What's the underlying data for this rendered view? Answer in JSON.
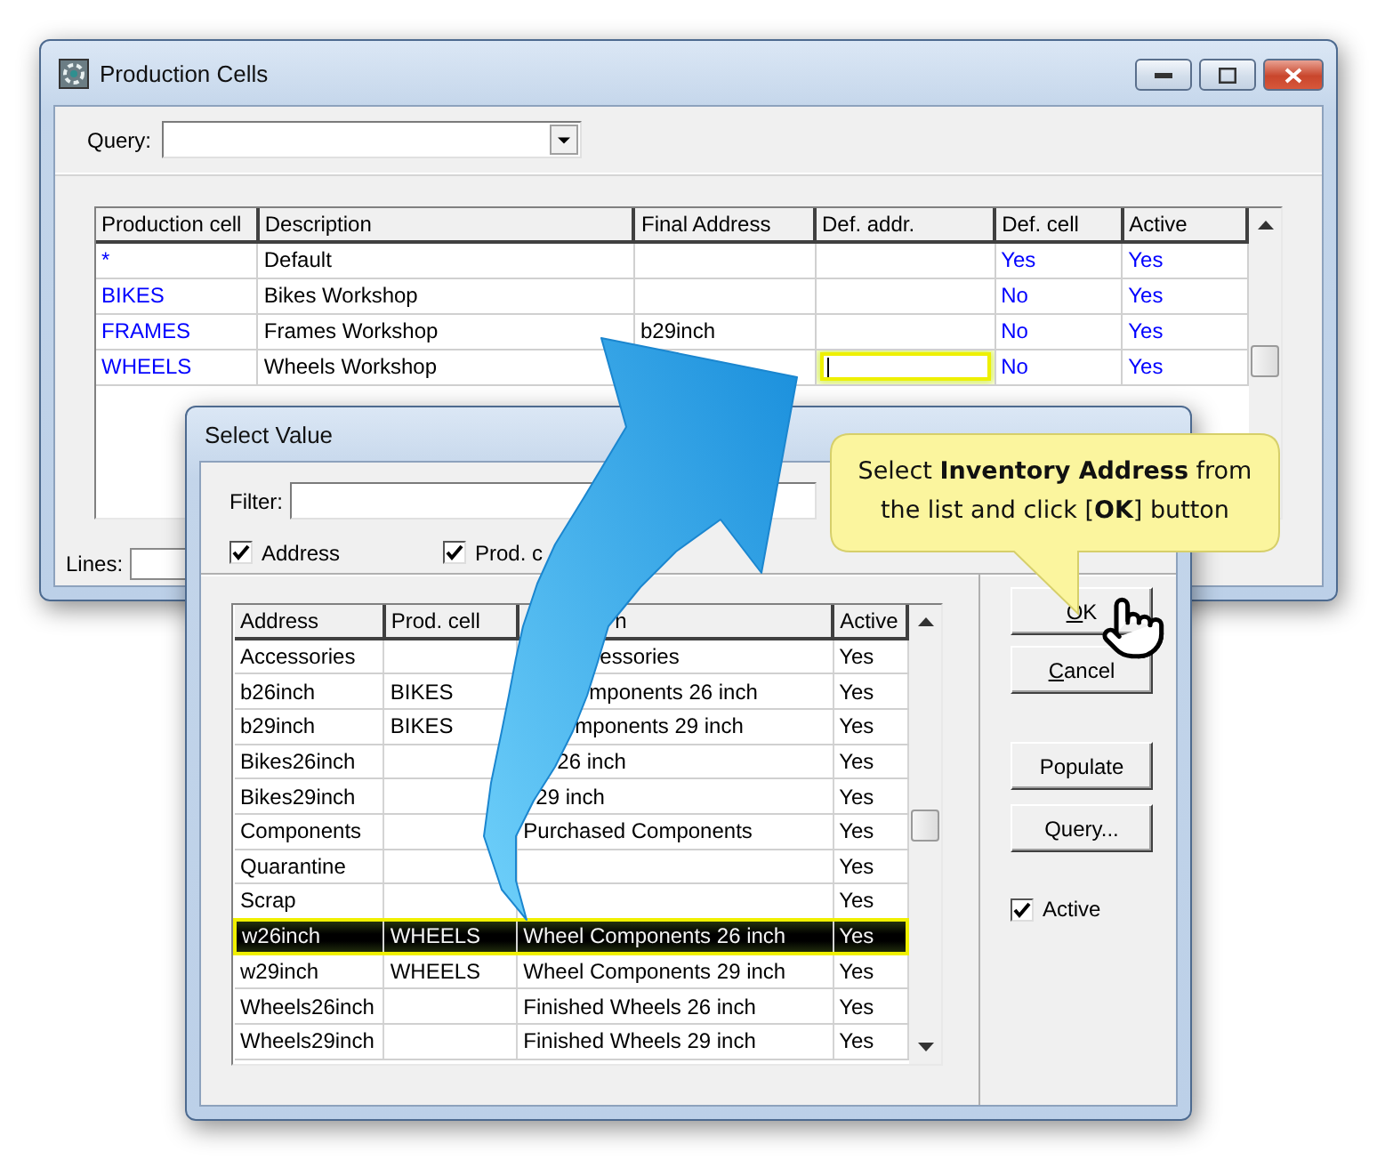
{
  "main_window": {
    "title": "Production Cells",
    "query": {
      "label": "Query:"
    },
    "table": {
      "columns": [
        "Production cell",
        "Description",
        "Final Address",
        "Def. addr.",
        "Def. cell",
        "Active"
      ],
      "rows": [
        {
          "production_cell": "*",
          "description": "Default",
          "def_cell": "Yes",
          "active": "Yes",
          "editing": false
        },
        {
          "production_cell": "BIKES",
          "description": "Bikes Workshop",
          "def_cell": "No",
          "active": "Yes",
          "editing": false
        },
        {
          "production_cell": "FRAMES",
          "description": "Frames Workshop",
          "final_address": "b29inch",
          "def_cell": "No",
          "active": "Yes",
          "editing": false
        },
        {
          "production_cell": "WHEELS",
          "description": "Wheels Workshop",
          "def_cell": "No",
          "active": "Yes",
          "editing": true
        }
      ]
    },
    "status_bar": {
      "label": "Lines:"
    }
  },
  "dialog": {
    "title": "Select Value",
    "filter": {
      "label": "Filter:"
    },
    "checkboxes": [
      {
        "label": "Address",
        "checked": true
      },
      {
        "label": "Prod. c",
        "checked": true
      }
    ],
    "table": {
      "columns": [
        "Address",
        "Prod. cell",
        "n",
        "Active"
      ],
      "rows": [
        {
          "address": "Accessories",
          "column_3": "essories",
          "active": "Yes",
          "selected": false
        },
        {
          "address": "b26inch",
          "prod_cell": "BIKES",
          "column_3": "mponents 26 inch",
          "active": "Yes",
          "selected": false
        },
        {
          "address": "b29inch",
          "prod_cell": "BIKES",
          "column_3": "mponents 29 inch",
          "active": "Yes",
          "selected": false
        },
        {
          "address": "Bikes26inch",
          "column_3": "26 inch",
          "active": "Yes",
          "selected": false
        },
        {
          "address": "Bikes29inch",
          "column_3": "29 inch",
          "active": "Yes",
          "selected": false
        },
        {
          "address": "Components",
          "column_3": "Purchased Components",
          "active": "Yes",
          "selected": false
        },
        {
          "address": "Quarantine",
          "active": "Yes",
          "selected": false
        },
        {
          "address": "Scrap",
          "active": "Yes",
          "selected": false
        },
        {
          "address": "w26inch",
          "prod_cell": "WHEELS",
          "column_3": "Wheel Components 26 inch",
          "active": "Yes",
          "selected": true
        },
        {
          "address": "w29inch",
          "prod_cell": "WHEELS",
          "column_3": "Wheel Components 29 inch",
          "active": "Yes",
          "selected": false
        },
        {
          "address": "Wheels26inch",
          "column_3": "Finished Wheels 26 inch",
          "active": "Yes",
          "selected": false
        },
        {
          "address": "Wheels29inch",
          "column_3": "Finished Wheels 29 inch",
          "active": "Yes",
          "selected": false
        }
      ]
    },
    "buttons": [
      {
        "label": "OK",
        "mnemonic": true
      },
      {
        "label": "Cancel",
        "mnemonic": true
      },
      {
        "label": "Populate",
        "mnemonic": false
      },
      {
        "label": "Query...",
        "mnemonic": false
      }
    ],
    "active_checkbox": {
      "label": "Active",
      "checked": true
    }
  },
  "callout": {
    "text": "Select **Inventory Address** from the list and click [**OK**] button"
  }
}
